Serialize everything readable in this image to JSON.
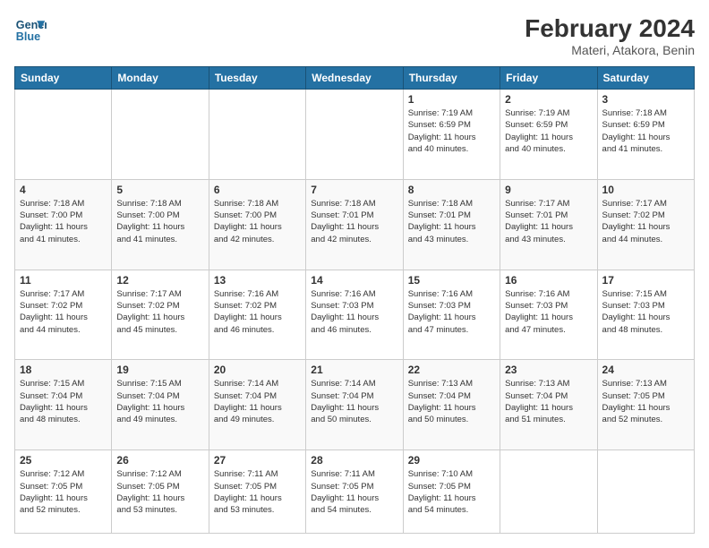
{
  "logo": {
    "line1": "General",
    "line2": "Blue"
  },
  "title": "February 2024",
  "subtitle": "Materi, Atakora, Benin",
  "days": [
    "Sunday",
    "Monday",
    "Tuesday",
    "Wednesday",
    "Thursday",
    "Friday",
    "Saturday"
  ],
  "weeks": [
    [
      {
        "day": "",
        "content": ""
      },
      {
        "day": "",
        "content": ""
      },
      {
        "day": "",
        "content": ""
      },
      {
        "day": "",
        "content": ""
      },
      {
        "day": "1",
        "content": "Sunrise: 7:19 AM\nSunset: 6:59 PM\nDaylight: 11 hours\nand 40 minutes."
      },
      {
        "day": "2",
        "content": "Sunrise: 7:19 AM\nSunset: 6:59 PM\nDaylight: 11 hours\nand 40 minutes."
      },
      {
        "day": "3",
        "content": "Sunrise: 7:18 AM\nSunset: 6:59 PM\nDaylight: 11 hours\nand 41 minutes."
      }
    ],
    [
      {
        "day": "4",
        "content": "Sunrise: 7:18 AM\nSunset: 7:00 PM\nDaylight: 11 hours\nand 41 minutes."
      },
      {
        "day": "5",
        "content": "Sunrise: 7:18 AM\nSunset: 7:00 PM\nDaylight: 11 hours\nand 41 minutes."
      },
      {
        "day": "6",
        "content": "Sunrise: 7:18 AM\nSunset: 7:00 PM\nDaylight: 11 hours\nand 42 minutes."
      },
      {
        "day": "7",
        "content": "Sunrise: 7:18 AM\nSunset: 7:01 PM\nDaylight: 11 hours\nand 42 minutes."
      },
      {
        "day": "8",
        "content": "Sunrise: 7:18 AM\nSunset: 7:01 PM\nDaylight: 11 hours\nand 43 minutes."
      },
      {
        "day": "9",
        "content": "Sunrise: 7:17 AM\nSunset: 7:01 PM\nDaylight: 11 hours\nand 43 minutes."
      },
      {
        "day": "10",
        "content": "Sunrise: 7:17 AM\nSunset: 7:02 PM\nDaylight: 11 hours\nand 44 minutes."
      }
    ],
    [
      {
        "day": "11",
        "content": "Sunrise: 7:17 AM\nSunset: 7:02 PM\nDaylight: 11 hours\nand 44 minutes."
      },
      {
        "day": "12",
        "content": "Sunrise: 7:17 AM\nSunset: 7:02 PM\nDaylight: 11 hours\nand 45 minutes."
      },
      {
        "day": "13",
        "content": "Sunrise: 7:16 AM\nSunset: 7:02 PM\nDaylight: 11 hours\nand 46 minutes."
      },
      {
        "day": "14",
        "content": "Sunrise: 7:16 AM\nSunset: 7:03 PM\nDaylight: 11 hours\nand 46 minutes."
      },
      {
        "day": "15",
        "content": "Sunrise: 7:16 AM\nSunset: 7:03 PM\nDaylight: 11 hours\nand 47 minutes."
      },
      {
        "day": "16",
        "content": "Sunrise: 7:16 AM\nSunset: 7:03 PM\nDaylight: 11 hours\nand 47 minutes."
      },
      {
        "day": "17",
        "content": "Sunrise: 7:15 AM\nSunset: 7:03 PM\nDaylight: 11 hours\nand 48 minutes."
      }
    ],
    [
      {
        "day": "18",
        "content": "Sunrise: 7:15 AM\nSunset: 7:04 PM\nDaylight: 11 hours\nand 48 minutes."
      },
      {
        "day": "19",
        "content": "Sunrise: 7:15 AM\nSunset: 7:04 PM\nDaylight: 11 hours\nand 49 minutes."
      },
      {
        "day": "20",
        "content": "Sunrise: 7:14 AM\nSunset: 7:04 PM\nDaylight: 11 hours\nand 49 minutes."
      },
      {
        "day": "21",
        "content": "Sunrise: 7:14 AM\nSunset: 7:04 PM\nDaylight: 11 hours\nand 50 minutes."
      },
      {
        "day": "22",
        "content": "Sunrise: 7:13 AM\nSunset: 7:04 PM\nDaylight: 11 hours\nand 50 minutes."
      },
      {
        "day": "23",
        "content": "Sunrise: 7:13 AM\nSunset: 7:04 PM\nDaylight: 11 hours\nand 51 minutes."
      },
      {
        "day": "24",
        "content": "Sunrise: 7:13 AM\nSunset: 7:05 PM\nDaylight: 11 hours\nand 52 minutes."
      }
    ],
    [
      {
        "day": "25",
        "content": "Sunrise: 7:12 AM\nSunset: 7:05 PM\nDaylight: 11 hours\nand 52 minutes."
      },
      {
        "day": "26",
        "content": "Sunrise: 7:12 AM\nSunset: 7:05 PM\nDaylight: 11 hours\nand 53 minutes."
      },
      {
        "day": "27",
        "content": "Sunrise: 7:11 AM\nSunset: 7:05 PM\nDaylight: 11 hours\nand 53 minutes."
      },
      {
        "day": "28",
        "content": "Sunrise: 7:11 AM\nSunset: 7:05 PM\nDaylight: 11 hours\nand 54 minutes."
      },
      {
        "day": "29",
        "content": "Sunrise: 7:10 AM\nSunset: 7:05 PM\nDaylight: 11 hours\nand 54 minutes."
      },
      {
        "day": "",
        "content": ""
      },
      {
        "day": "",
        "content": ""
      }
    ]
  ]
}
